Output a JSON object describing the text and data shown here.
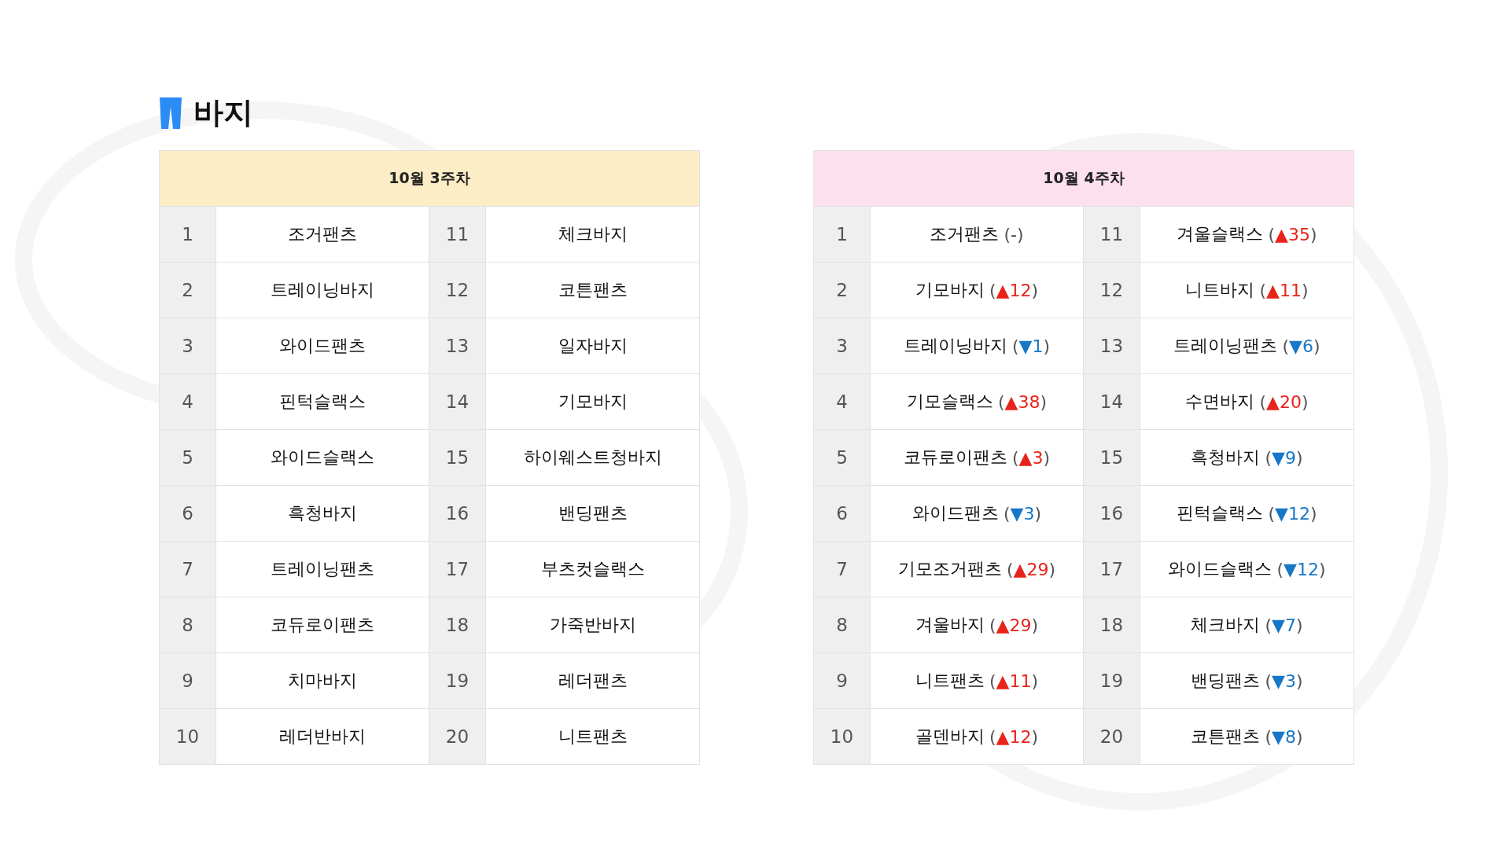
{
  "title": "바지",
  "tables": [
    {
      "heading": "10월 3주차",
      "color": "#fdedc6",
      "entries": [
        {
          "rank": "1",
          "name": "조거팬츠"
        },
        {
          "rank": "2",
          "name": "트레이닝바지"
        },
        {
          "rank": "3",
          "name": "와이드팬츠"
        },
        {
          "rank": "4",
          "name": "핀턱슬랙스"
        },
        {
          "rank": "5",
          "name": "와이드슬랙스"
        },
        {
          "rank": "6",
          "name": "흑청바지"
        },
        {
          "rank": "7",
          "name": "트레이닝팬츠"
        },
        {
          "rank": "8",
          "name": "코듀로이팬츠"
        },
        {
          "rank": "9",
          "name": "치마바지"
        },
        {
          "rank": "10",
          "name": "레더반바지"
        },
        {
          "rank": "11",
          "name": "체크바지"
        },
        {
          "rank": "12",
          "name": "코튼팬츠"
        },
        {
          "rank": "13",
          "name": "일자바지"
        },
        {
          "rank": "14",
          "name": "기모바지"
        },
        {
          "rank": "15",
          "name": "하이웨스트청바지"
        },
        {
          "rank": "16",
          "name": "밴딩팬츠"
        },
        {
          "rank": "17",
          "name": "부츠컷슬랙스"
        },
        {
          "rank": "18",
          "name": "가죽반바지"
        },
        {
          "rank": "19",
          "name": "레더팬츠"
        },
        {
          "rank": "20",
          "name": "니트팬츠"
        }
      ]
    },
    {
      "heading": "10월 4주차",
      "color": "#fde0ee",
      "entries": [
        {
          "rank": "1",
          "name": "조거팬츠",
          "change": "(-)",
          "kind": "same"
        },
        {
          "rank": "2",
          "name": "기모바지",
          "change": "(▲12)",
          "kind": "up"
        },
        {
          "rank": "3",
          "name": "트레이닝바지",
          "change": "(▼1)",
          "kind": "down"
        },
        {
          "rank": "4",
          "name": "기모슬랙스",
          "change": "(▲38)",
          "kind": "up"
        },
        {
          "rank": "5",
          "name": "코듀로이팬츠",
          "change": "(▲3)",
          "kind": "up"
        },
        {
          "rank": "6",
          "name": "와이드팬츠",
          "change": "(▼3)",
          "kind": "down"
        },
        {
          "rank": "7",
          "name": "기모조거팬츠",
          "change": "(▲29)",
          "kind": "up"
        },
        {
          "rank": "8",
          "name": "겨울바지",
          "change": "(▲29)",
          "kind": "up"
        },
        {
          "rank": "9",
          "name": "니트팬츠",
          "change": "(▲11)",
          "kind": "up"
        },
        {
          "rank": "10",
          "name": "골덴바지",
          "change": "(▲12)",
          "kind": "up"
        },
        {
          "rank": "11",
          "name": "겨울슬랙스",
          "change": "(▲35)",
          "kind": "up"
        },
        {
          "rank": "12",
          "name": "니트바지",
          "change": "(▲11)",
          "kind": "up"
        },
        {
          "rank": "13",
          "name": "트레이닝팬츠",
          "change": "(▼6)",
          "kind": "down"
        },
        {
          "rank": "14",
          "name": "수면바지",
          "change": "(▲20)",
          "kind": "up"
        },
        {
          "rank": "15",
          "name": "흑청바지",
          "change": "(▼9)",
          "kind": "down"
        },
        {
          "rank": "16",
          "name": "핀턱슬랙스",
          "change": "(▼12)",
          "kind": "down"
        },
        {
          "rank": "17",
          "name": "와이드슬랙스",
          "change": "(▼12)",
          "kind": "down"
        },
        {
          "rank": "18",
          "name": "체크바지",
          "change": "(▼7)",
          "kind": "down"
        },
        {
          "rank": "19",
          "name": "밴딩팬츠",
          "change": "(▼3)",
          "kind": "down"
        },
        {
          "rank": "20",
          "name": "코튼팬츠",
          "change": "(▼8)",
          "kind": "down"
        }
      ]
    }
  ]
}
